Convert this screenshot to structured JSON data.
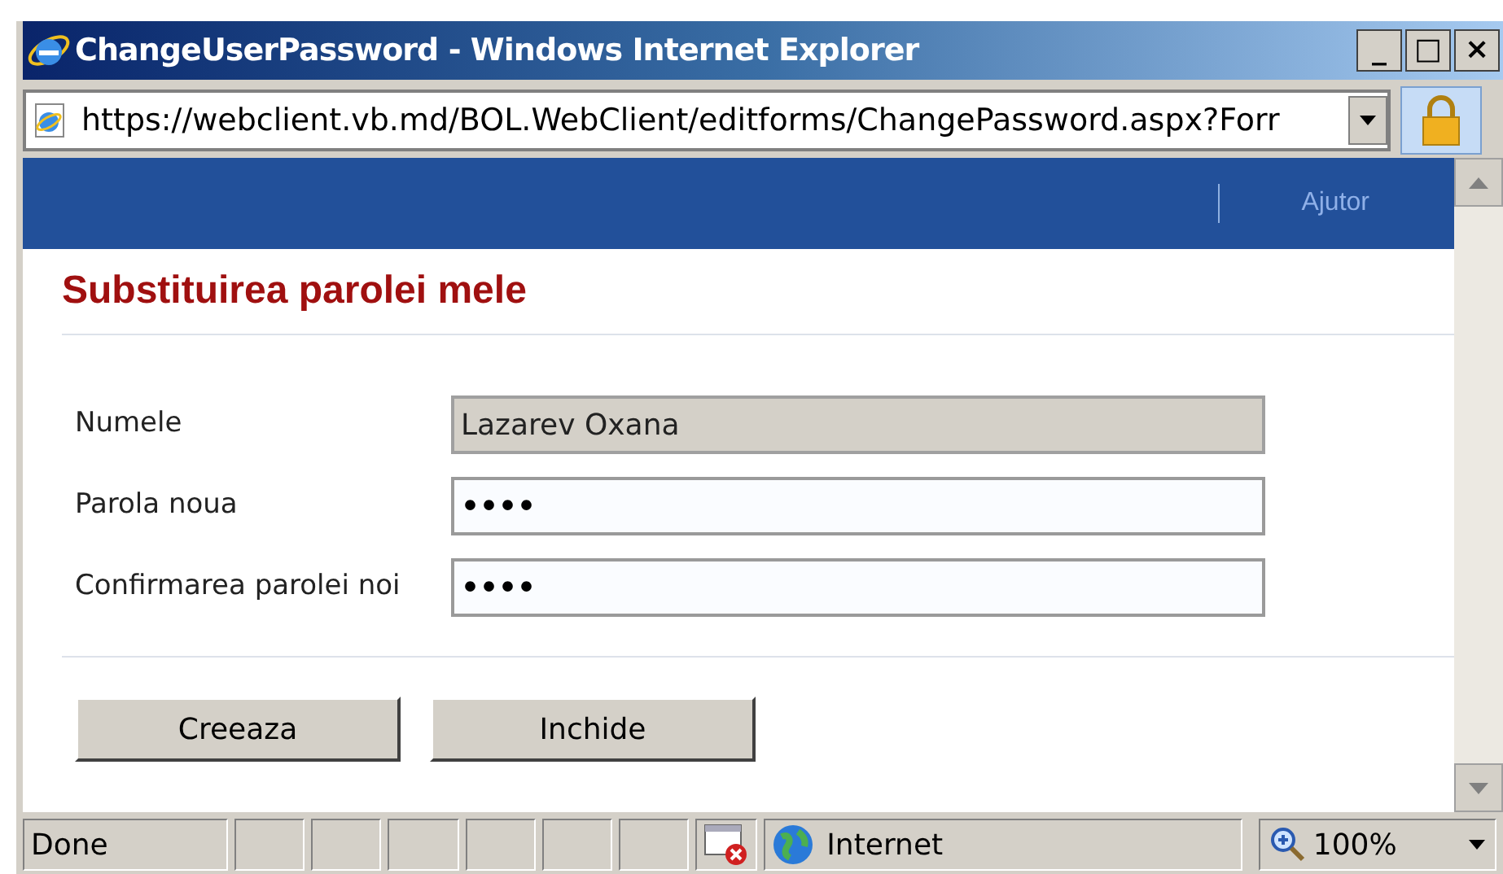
{
  "window": {
    "title": "ChangeUserPassword - Windows Internet Explorer",
    "controls": [
      "_",
      "□",
      "×"
    ]
  },
  "address_bar": {
    "url": "https://webclient.vb.md/BOL.WebClient/editforms/ChangePassword.aspx?Forr"
  },
  "header": {
    "links": [
      "Ajutor"
    ]
  },
  "form": {
    "title": "Substituirea parolei mele",
    "fields": [
      {
        "label": "Numele",
        "value": "Lazarev Oxana",
        "disabled": true
      },
      {
        "label": "Parola noua",
        "value": "••••",
        "disabled": false
      },
      {
        "label": "Confirmarea parolei noi",
        "value": "••••",
        "disabled": false
      }
    ],
    "buttons": [
      "Creeaza",
      "Inchide"
    ]
  },
  "status_bar": {
    "text": "Done",
    "zone": "Internet",
    "zoom": "100%"
  }
}
